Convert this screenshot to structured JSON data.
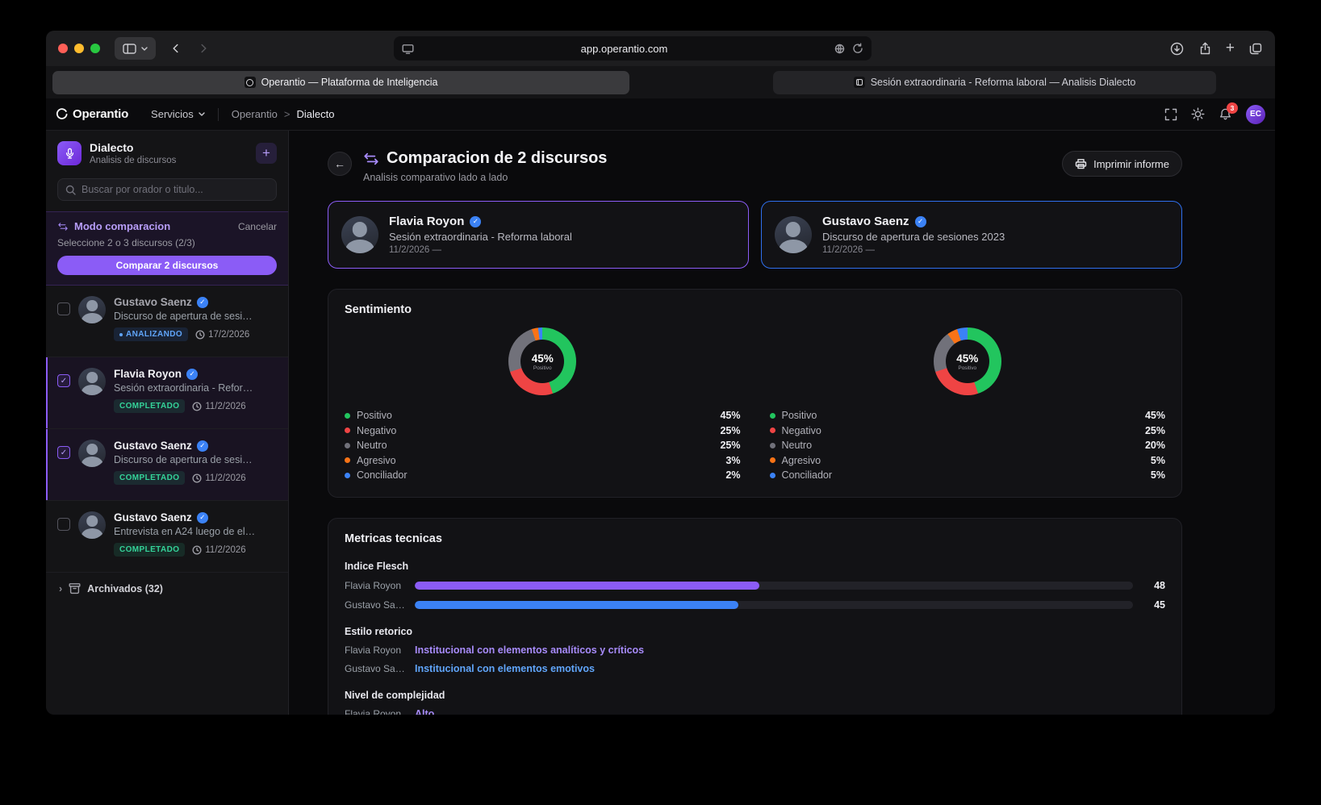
{
  "colors": {
    "accent_purple": "#8b5cf6",
    "accent_purple_text": "#a78bfa",
    "accent_blue": "#3b82f6",
    "accent_blue_text": "#60a5fa",
    "positive_green": "#22c55e",
    "negative_red": "#ef4444",
    "neutral_gray": "#71717a",
    "aggressive_orange": "#f97316",
    "completed_green": "#34d399",
    "notification_red": "#ef4444"
  },
  "icons": {
    "check": "✓",
    "plus": "+",
    "back_arrow": "←",
    "chevron_right": "›"
  },
  "browser": {
    "url": "app.operantio.com",
    "tabs": [
      {
        "label": "Operantio — Plataforma de Inteligencia",
        "active": true
      },
      {
        "label": "Sesión extraordinaria - Reforma laboral — Analisis Dialecto",
        "active": false
      }
    ]
  },
  "app_header": {
    "logo": "Operantio",
    "services": "Servicios",
    "breadcrumb": {
      "root": "Operantio",
      "separator": ">",
      "current": "Dialecto"
    },
    "notifications_badge": "3",
    "avatar_initials": "EC"
  },
  "sidebar": {
    "tool_name": "Dialecto",
    "tool_subtitle": "Analisis de discursos",
    "search_placeholder": "Buscar por orador o titulo...",
    "comparison": {
      "title": "Modo comparacion",
      "cancel": "Cancelar",
      "instruction": "Seleccione 2 o 3 discursos (2/3)",
      "button": "Comparar 2 discursos"
    },
    "items": [
      {
        "speaker": "Gustavo Saenz",
        "verified": true,
        "title": "Discurso de apertura de sesi…",
        "status": "ANALIZANDO",
        "status_dot": true,
        "dimmed": true,
        "status_fg": "#60a5fa",
        "status_bg": "rgba(59,130,246,0.14)",
        "date": "17/2/2026",
        "checked": false,
        "selected": false
      },
      {
        "speaker": "Flavia Royon",
        "verified": true,
        "title": "Sesión extraordinaria - Refor…",
        "status": "COMPLETADO",
        "status_dot": false,
        "dimmed": false,
        "status_fg": "#34d399",
        "status_bg": "rgba(52,211,153,0.12)",
        "date": "11/2/2026",
        "checked": true,
        "selected": true
      },
      {
        "speaker": "Gustavo Saenz",
        "verified": true,
        "title": "Discurso de apertura de sesi…",
        "status": "COMPLETADO",
        "status_dot": false,
        "dimmed": false,
        "status_fg": "#34d399",
        "status_bg": "rgba(52,211,153,0.12)",
        "date": "11/2/2026",
        "checked": true,
        "selected": true
      },
      {
        "speaker": "Gustavo Saenz",
        "verified": true,
        "title": "Entrevista en A24 luego de el…",
        "status": "COMPLETADO",
        "status_dot": false,
        "dimmed": false,
        "status_fg": "#34d399",
        "status_bg": "rgba(52,211,153,0.12)",
        "date": "11/2/2026",
        "checked": false,
        "selected": false
      }
    ],
    "archived": "Archivados (32)"
  },
  "main": {
    "title": "Comparacion de 2 discursos",
    "subtitle": "Analisis comparativo lado a lado",
    "print_button": "Imprimir informe",
    "speakers": [
      {
        "name": "Flavia Royon",
        "verified": true,
        "speech": "Sesión extraordinaria - Reforma laboral",
        "date": "11/2/2026 —",
        "accent": "#8b5cf6"
      },
      {
        "name": "Gustavo Saenz",
        "verified": true,
        "speech": "Discurso de apertura de sesiones 2023",
        "date": "11/2/2026 —",
        "accent": "#2f6fed"
      }
    ],
    "sentiment": {
      "title": "Sentimiento",
      "charts": [
        {
          "center_value": "45%",
          "center_label": "Positivo",
          "segments": [
            {
              "label": "Positivo",
              "value": 45,
              "pct": "45%",
              "color": "#22c55e"
            },
            {
              "label": "Negativo",
              "value": 25,
              "pct": "25%",
              "color": "#ef4444"
            },
            {
              "label": "Neutro",
              "value": 25,
              "pct": "25%",
              "color": "#71717a"
            },
            {
              "label": "Agresivo",
              "value": 3,
              "pct": "3%",
              "color": "#f97316"
            },
            {
              "label": "Conciliador",
              "value": 2,
              "pct": "2%",
              "color": "#3b82f6"
            }
          ]
        },
        {
          "center_value": "45%",
          "center_label": "Positivo",
          "segments": [
            {
              "label": "Positivo",
              "value": 45,
              "pct": "45%",
              "color": "#22c55e"
            },
            {
              "label": "Negativo",
              "value": 25,
              "pct": "25%",
              "color": "#ef4444"
            },
            {
              "label": "Neutro",
              "value": 20,
              "pct": "20%",
              "color": "#71717a"
            },
            {
              "label": "Agresivo",
              "value": 5,
              "pct": "5%",
              "color": "#f97316"
            },
            {
              "label": "Conciliador",
              "value": 5,
              "pct": "5%",
              "color": "#3b82f6"
            }
          ]
        }
      ]
    },
    "metrics": {
      "title": "Metricas tecnicas",
      "flesch": {
        "heading": "Indice Flesch",
        "rows": [
          {
            "label": "Flavia Royon",
            "value": 48,
            "display": "48",
            "color": "#8b5cf6"
          },
          {
            "label": "Gustavo Sa…",
            "value": 45,
            "display": "45",
            "color": "#3b82f6"
          }
        ]
      },
      "style": {
        "heading": "Estilo retorico",
        "rows": [
          {
            "label": "Flavia Royon",
            "text": "Institucional con elementos analíticos y críticos",
            "color": "#a78bfa"
          },
          {
            "label": "Gustavo Sa…",
            "text": "Institucional con elementos emotivos",
            "color": "#60a5fa"
          }
        ]
      },
      "complexity": {
        "heading": "Nivel de complejidad",
        "rows": [
          {
            "label": "Flavia Royon",
            "text": "Alto",
            "color": "#a78bfa"
          }
        ]
      }
    }
  },
  "chart_data": [
    {
      "type": "pie",
      "title": "Sentimiento — Flavia Royon",
      "labels": [
        "Positivo",
        "Negativo",
        "Neutro",
        "Agresivo",
        "Conciliador"
      ],
      "values": [
        45,
        25,
        25,
        3,
        2
      ],
      "center": "45% Positivo",
      "legend_position": "bottom"
    },
    {
      "type": "pie",
      "title": "Sentimiento — Gustavo Saenz",
      "labels": [
        "Positivo",
        "Negativo",
        "Neutro",
        "Agresivo",
        "Conciliador"
      ],
      "values": [
        45,
        25,
        20,
        5,
        5
      ],
      "center": "45% Positivo",
      "legend_position": "bottom"
    },
    {
      "type": "bar",
      "title": "Indice Flesch",
      "categories": [
        "Flavia Royon",
        "Gustavo Sa…"
      ],
      "values": [
        48,
        45
      ],
      "xlim": [
        0,
        100
      ]
    }
  ]
}
